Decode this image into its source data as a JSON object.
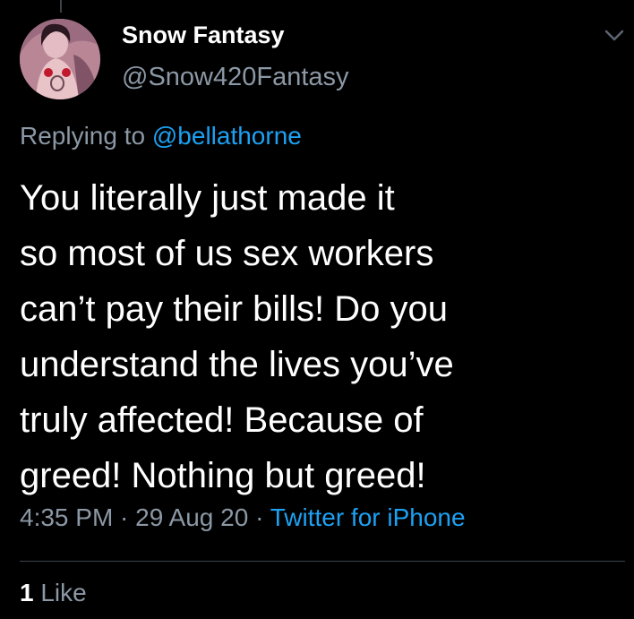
{
  "tweet": {
    "author": {
      "display_name": "Snow Fantasy",
      "handle": "@Snow420Fantasy",
      "avatar_icon": "profile-photo"
    },
    "reply": {
      "prefix": "Replying to ",
      "mention": "@bellathorne"
    },
    "text_lines": [
      "You literally just made it",
      "so most of us sex workers",
      "can’t pay their bills! Do you",
      "understand the lives you’ve",
      "truly affected! Because of",
      "greed! Nothing but greed!"
    ],
    "meta": {
      "time": "4:35 PM",
      "separator": " · ",
      "date": "29 Aug 20",
      "source": "Twitter for iPhone"
    },
    "stats": {
      "likes_count": "1",
      "likes_label": "Like"
    }
  },
  "colors": {
    "background": "#000000",
    "text": "#ffffff",
    "secondary": "#8b98a5",
    "accent": "#1da1f2",
    "divider": "#38444d"
  }
}
